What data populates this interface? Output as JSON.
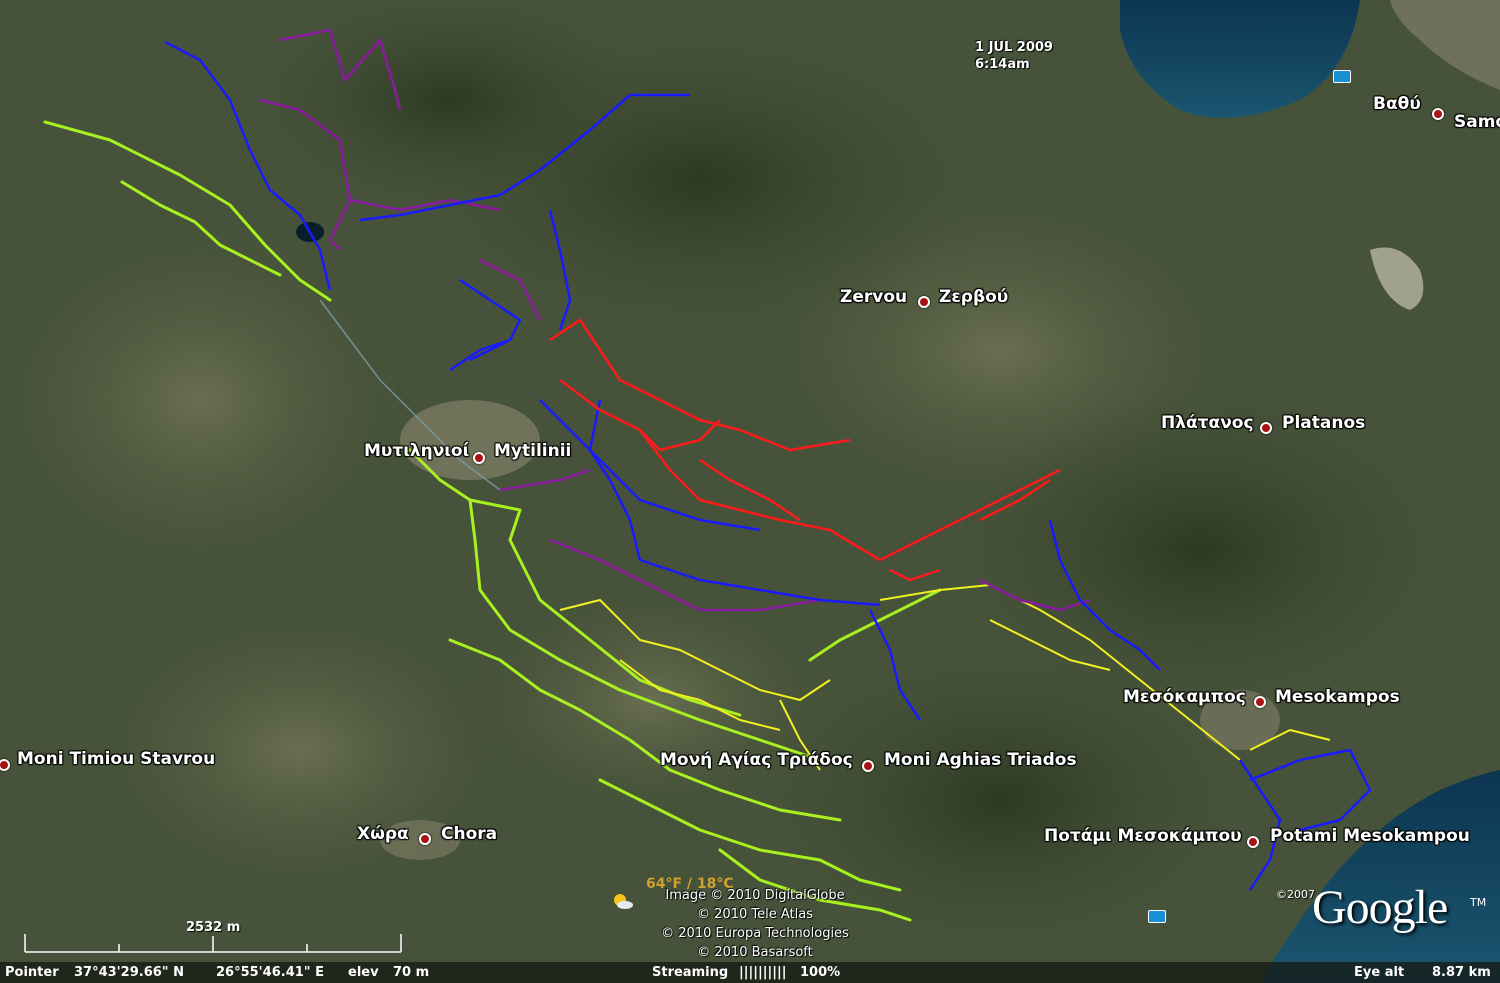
{
  "overlay": {
    "date": "1 JUL 2009",
    "time": "6:14am"
  },
  "places": [
    {
      "id": "vathy",
      "text_left": "Βαθύ",
      "text_right": "Samo"
    },
    {
      "id": "zervou",
      "text_left": "Zervou",
      "text_right": "Ζερβού"
    },
    {
      "id": "platanos",
      "text_left": "Πλάτανος",
      "text_right": "Platanos"
    },
    {
      "id": "mytilinii",
      "text_left": "Μυτιληνιοί",
      "text_right": "Mytilinii"
    },
    {
      "id": "mesokampos",
      "text_left": "Μεσόκαμπος",
      "text_right": "Mesokampos"
    },
    {
      "id": "moni-timiou",
      "text_left": "",
      "text_right": "Moni Timiou Stavrou"
    },
    {
      "id": "moni-aghias",
      "text_left": "Μονή Αγίας Τριάδος",
      "text_right": "Moni Aghias Triados"
    },
    {
      "id": "chora",
      "text_left": "Χώρα",
      "text_right": "Chora"
    },
    {
      "id": "potami",
      "text_left": "Ποτάμι Μεσοκάμπου",
      "text_right": "Potami Mesokampou"
    }
  ],
  "weather": {
    "text": "64°F / 18°C",
    "icon": "sun-cloud-icon"
  },
  "credits": [
    "Image © 2010 DigitalGlobe",
    "© 2010 Tele Atlas",
    "© 2010 Europa Technologies",
    "© 2010 Basarsoft"
  ],
  "scale": {
    "label": "2532 m"
  },
  "brand": {
    "logo": "Google",
    "copyright": "©2007",
    "tm": "TM"
  },
  "status": {
    "pointer_label": "Pointer",
    "lat": "37°43'29.66\" N",
    "lon": "26°55'46.41\" E",
    "elev_label": "elev",
    "elev_value": "70 m",
    "streaming_label": "Streaming",
    "streaming_bar": "||||||||||",
    "streaming_pct": "100%",
    "eye_label": "Eye alt",
    "eye_value": "8.87 km"
  },
  "colors": {
    "trail_red": "#ff1a1a",
    "trail_blue": "#1a1aff",
    "trail_purple": "#8a1aa0",
    "trail_yellow": "#f0f020",
    "trail_lime": "#a8f020",
    "sea": "#0e3c56"
  }
}
